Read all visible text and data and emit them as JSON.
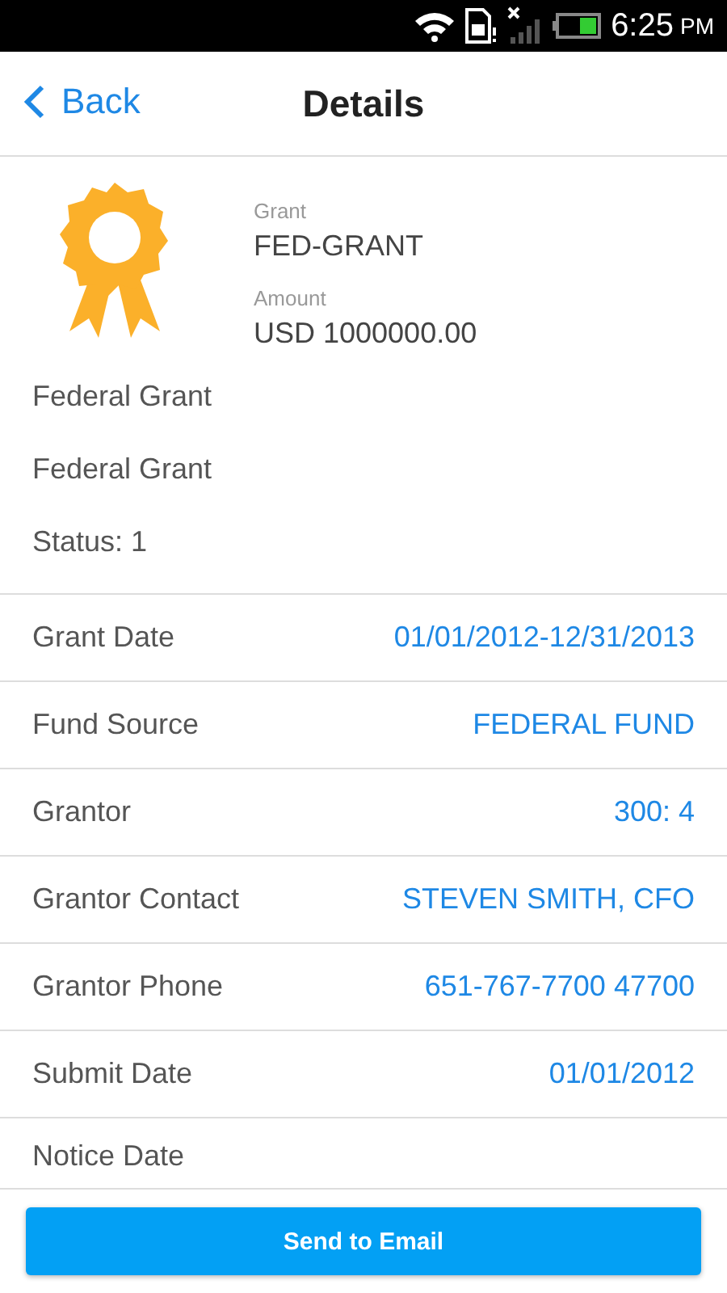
{
  "status_bar": {
    "time": "6:25",
    "time_suffix": "PM"
  },
  "header": {
    "back": "Back",
    "title": "Details"
  },
  "summary": {
    "fields": [
      {
        "label": "Grant",
        "value": "FED-GRANT"
      },
      {
        "label": "Amount",
        "value": "USD 1000000.00"
      }
    ],
    "lines": [
      "Federal Grant",
      "Federal Grant",
      "Status: 1"
    ]
  },
  "details": [
    {
      "label": "Grant Date",
      "value": "01/01/2012-12/31/2013"
    },
    {
      "label": "Fund Source",
      "value": "FEDERAL FUND"
    },
    {
      "label": "Grantor",
      "value": "300: 4"
    },
    {
      "label": "Grantor Contact",
      "value": "STEVEN SMITH, CFO"
    },
    {
      "label": "Grantor Phone",
      "value": "651-767-7700 47700"
    },
    {
      "label": "Submit Date",
      "value": "01/01/2012"
    },
    {
      "label": "Notice Date"
    }
  ],
  "button": "Send to Email"
}
